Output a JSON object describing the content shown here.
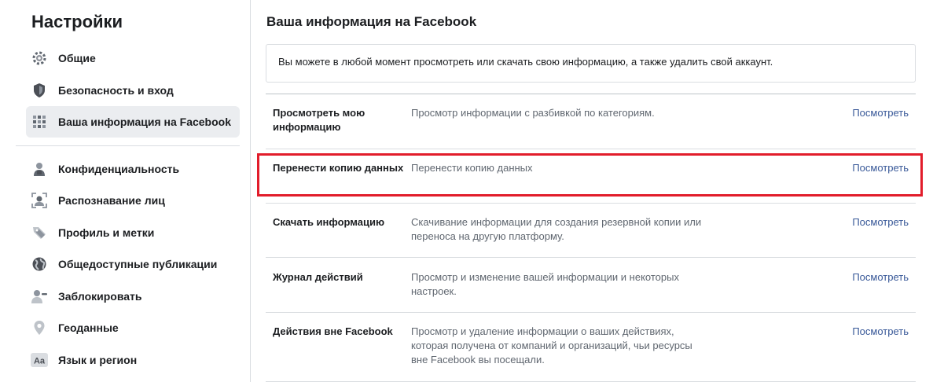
{
  "sidebar": {
    "title": "Настройки",
    "items": [
      {
        "label": "Общие",
        "icon": "gear-icon"
      },
      {
        "label": "Безопасность и вход",
        "icon": "shield-icon"
      },
      {
        "label": "Ваша информация на Facebook",
        "icon": "grid-icon",
        "active": true
      },
      {
        "label": "Конфиденциальность",
        "icon": "lock-icon"
      },
      {
        "label": "Распознавание лиц",
        "icon": "face-icon"
      },
      {
        "label": "Профиль и метки",
        "icon": "tag-icon"
      },
      {
        "label": "Общедоступные публикации",
        "icon": "globe-icon"
      },
      {
        "label": "Заблокировать",
        "icon": "block-user-icon"
      },
      {
        "label": "Геоданные",
        "icon": "location-pin-icon"
      },
      {
        "label": "Язык и регион",
        "icon": "language-icon"
      }
    ]
  },
  "main": {
    "title": "Ваша информация на Facebook",
    "info_text": "Вы можете в любой момент просмотреть или скачать свою информацию, а также удалить свой аккаунт.",
    "rows": [
      {
        "title": "Просмотреть мою информацию",
        "description": "Просмотр информации с разбивкой по категориям.",
        "link": "Посмотреть"
      },
      {
        "title": "Перенести копию данных",
        "description": "Перенести копию данных",
        "link": "Посмотреть"
      },
      {
        "title": "Скачать информацию",
        "description": "Скачивание информации для создания резервной копии или переноса на другую платформу.",
        "link": "Посмотреть"
      },
      {
        "title": "Журнал действий",
        "description": "Просмотр и изменение вашей информации и некоторых настроек.",
        "link": "Посмотреть"
      },
      {
        "title": "Действия вне Facebook",
        "description": "Просмотр и удаление информации о ваших действиях, которая получена от компаний и организаций, чьи ресурсы вне Facebook вы посещали.",
        "link": "Посмотреть"
      }
    ]
  },
  "colors": {
    "link": "#385898",
    "highlight": "#e21d2b",
    "active_item_bg": "#ebedf0"
  }
}
